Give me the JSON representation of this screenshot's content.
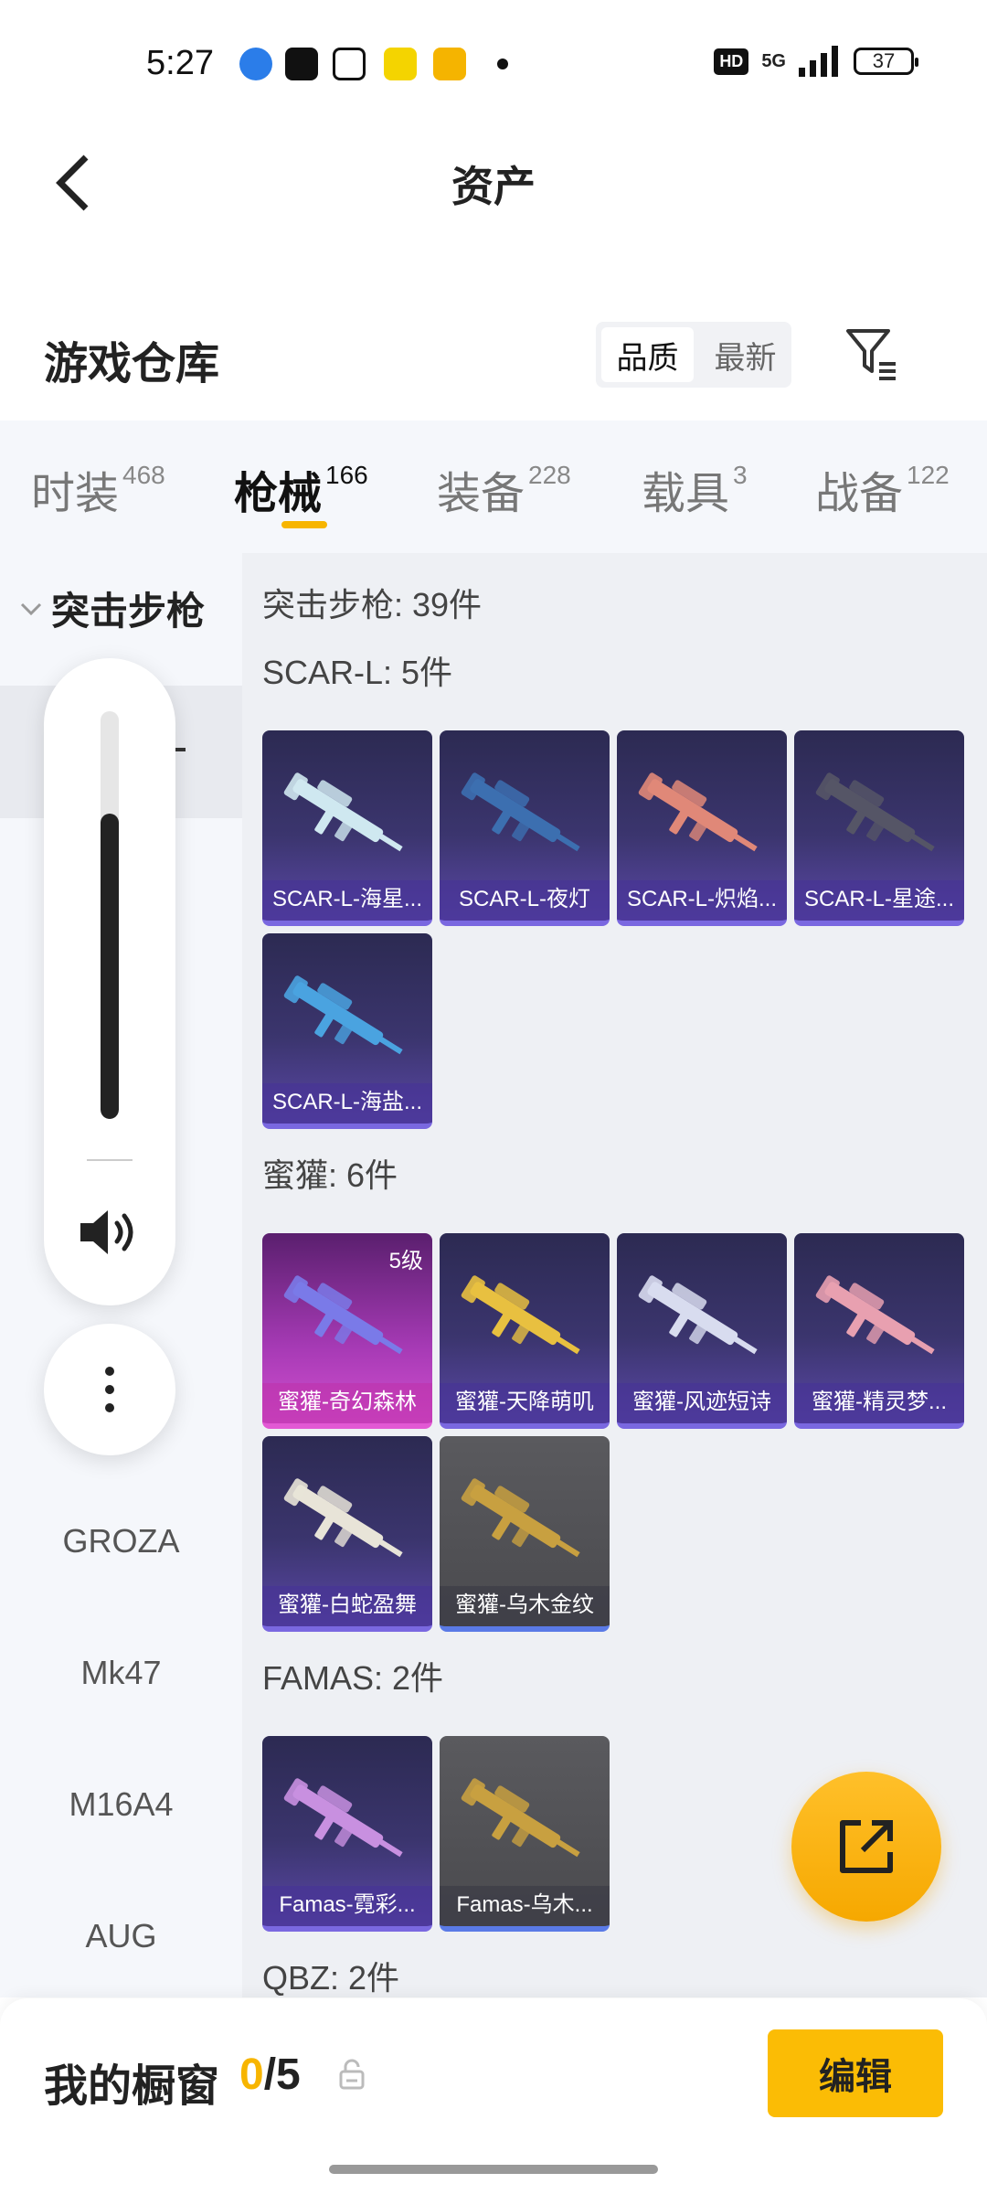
{
  "status_bar": {
    "time": "5:27",
    "network": "5G",
    "hd": "HD",
    "battery": "37",
    "app_icons": [
      "blue-app-icon",
      "tiktok-icon",
      "alipay-icon",
      "yellow-app-icon",
      "reader-app-icon"
    ]
  },
  "header": {
    "title": "资产"
  },
  "warehouse": {
    "title": "游戏仓库",
    "sort_options": [
      "品质",
      "最新"
    ],
    "active_sort": "品质"
  },
  "tabs": [
    {
      "label": "时装",
      "count": "468"
    },
    {
      "label": "枪械",
      "count": "166",
      "active": true
    },
    {
      "label": "装备",
      "count": "228"
    },
    {
      "label": "载具",
      "count": "3"
    },
    {
      "label": "战备",
      "count": "122"
    }
  ],
  "sidebar": {
    "group": "突击步枪",
    "items": [
      "GROZA",
      "Mk47",
      "M16A4",
      "AUG"
    ]
  },
  "volume": {
    "level": 0.75
  },
  "content": {
    "total": "突击步枪: 39件",
    "groups": [
      {
        "title": "SCAR-L: 5件",
        "items": [
          {
            "name": "SCAR-L-海星...",
            "style": "purple",
            "gun": "#cfe8f0"
          },
          {
            "name": "SCAR-L-夜灯",
            "style": "purple",
            "gun": "#3c6fb0"
          },
          {
            "name": "SCAR-L-炽焰...",
            "style": "purple",
            "gun": "#e08878"
          },
          {
            "name": "SCAR-L-星途...",
            "style": "purple",
            "gun": "#555566"
          },
          {
            "name": "SCAR-L-海盐...",
            "style": "purple",
            "gun": "#4aa3e0"
          }
        ]
      },
      {
        "title": "蜜獾: 6件",
        "items": [
          {
            "name": "蜜獾-奇幻森林",
            "style": "rare",
            "level": "5级",
            "gun": "#7a7ae8"
          },
          {
            "name": "蜜獾-天降萌叽",
            "style": "purple",
            "gun": "#e8c040"
          },
          {
            "name": "蜜獾-风迹短诗",
            "style": "purple",
            "gun": "#d8dcef"
          },
          {
            "name": "蜜獾-精灵梦...",
            "style": "purple",
            "gun": "#e8a0b0"
          },
          {
            "name": "蜜獾-白蛇盈舞",
            "style": "purple",
            "gun": "#e8e4d8"
          },
          {
            "name": "蜜獾-乌木金纹",
            "style": "gray",
            "gun": "#c8a040"
          }
        ]
      },
      {
        "title": "FAMAS: 2件",
        "items": [
          {
            "name": "Famas-霓彩...",
            "style": "purple",
            "gun": "#c890e0"
          },
          {
            "name": "Famas-乌木...",
            "style": "gray",
            "gun": "#c8a040"
          }
        ]
      },
      {
        "title": "QBZ: 2件",
        "items": []
      }
    ]
  },
  "bottom": {
    "showcase_label": "我的橱窗",
    "showcase_current": "0",
    "showcase_total": "/5",
    "edit_label": "编辑"
  },
  "colors": {
    "accent": "#f7b500",
    "card_purple": "#3b356e",
    "card_rare": "#a63ab5"
  }
}
